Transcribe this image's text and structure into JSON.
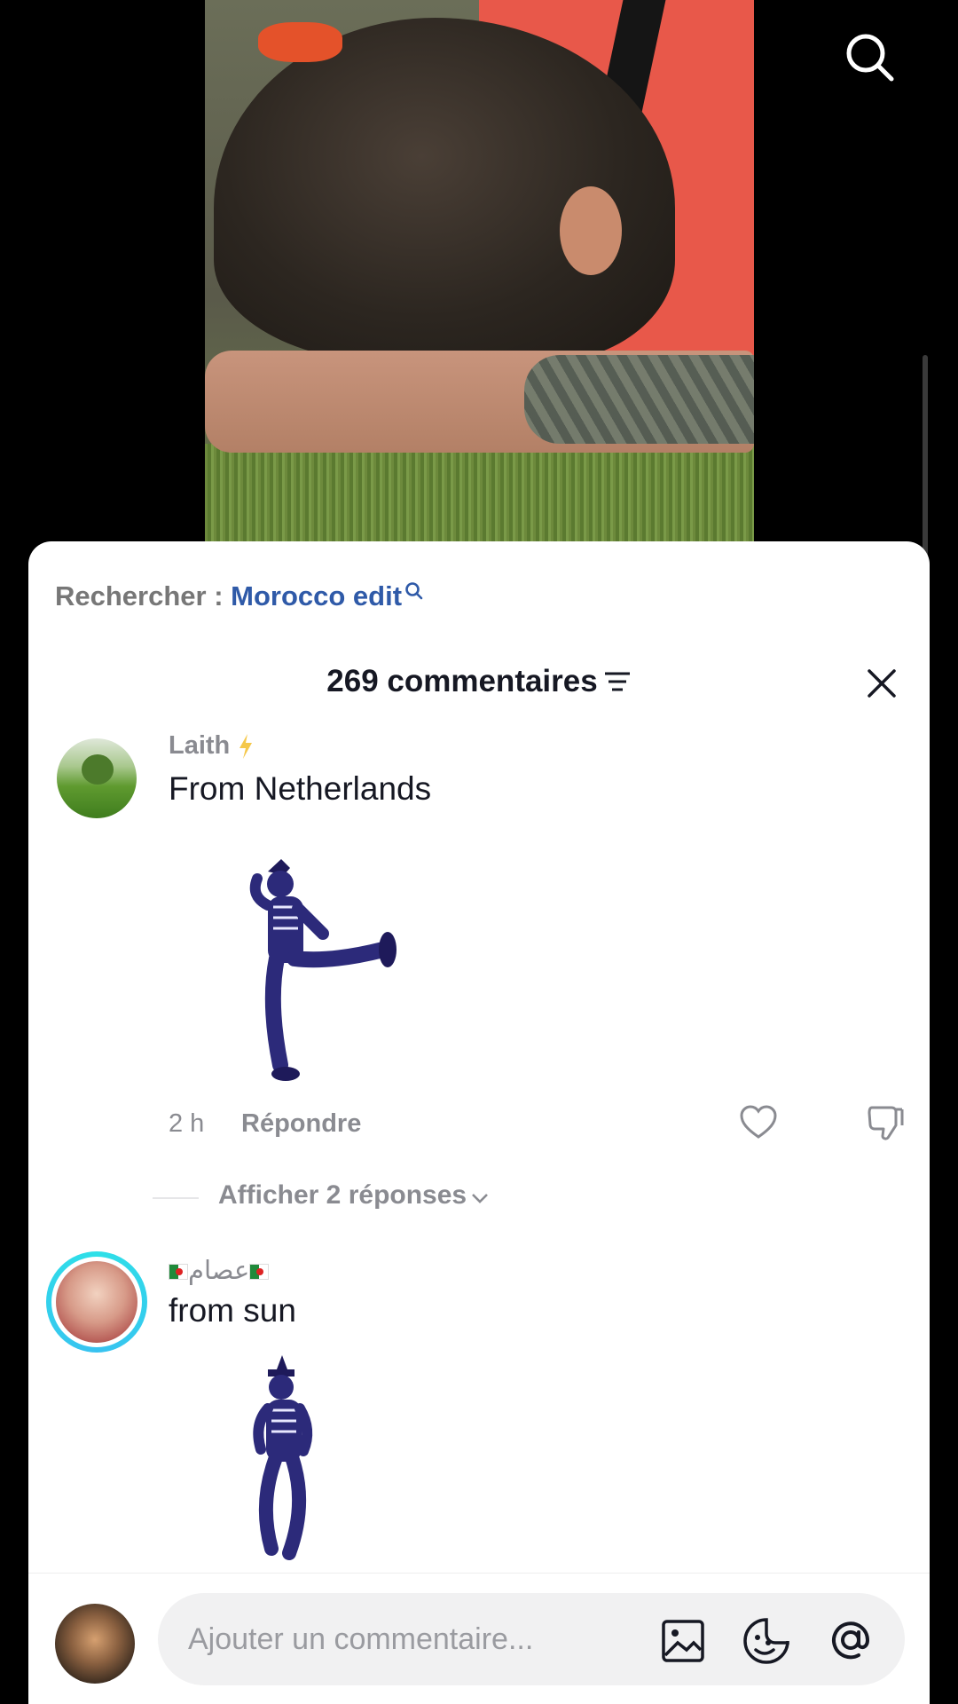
{
  "video": {
    "description_icon": "search-icon"
  },
  "search_suggestion": {
    "prefix": "Rechercher : ",
    "term": "Morocco edit"
  },
  "comments_header": {
    "title": "269 commentaires"
  },
  "comments": [
    {
      "username": "Laith",
      "text": "From Netherlands",
      "time": "2 h",
      "reply_label": "Répondre",
      "replies_label": "Afficher 2 réponses"
    },
    {
      "username": "عصام",
      "text": "from sun"
    }
  ],
  "input": {
    "placeholder": "Ajouter un commentaire..."
  },
  "colors": {
    "accent_link": "#2f5aa8",
    "ring": "#2ee0e8",
    "text": "#161823",
    "muted": "#8a8b91"
  }
}
